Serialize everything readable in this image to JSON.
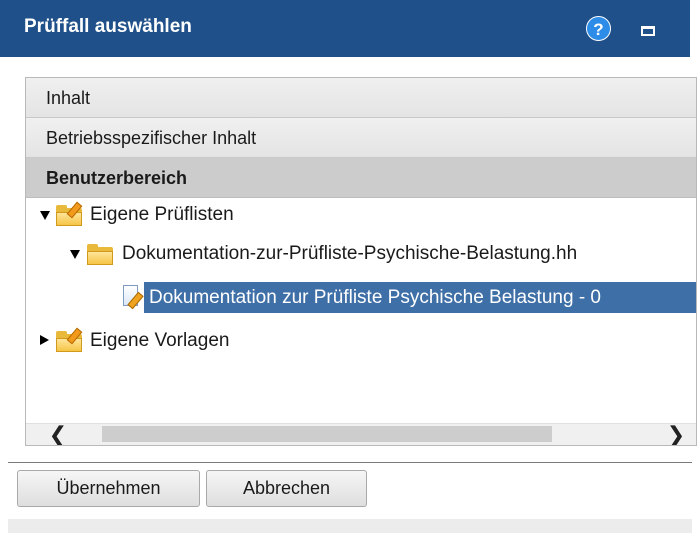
{
  "dialog": {
    "title": "Prüffall auswählen",
    "help_icon": "help-icon",
    "help_glyph": "?",
    "maximize_icon": "maximize-icon"
  },
  "accordion": {
    "sections": [
      {
        "label": "Inhalt"
      },
      {
        "label": "Betriebsspezifischer Inhalt"
      },
      {
        "label": "Benutzerbereich",
        "active": true
      }
    ]
  },
  "tree": {
    "nodes": [
      {
        "label": "Eigene Prüflisten",
        "icon": "folder-edit-icon",
        "expanded": true
      },
      {
        "label": "Dokumentation-zur-Prüfliste-Psychische-Belastung.hh",
        "icon": "folder-icon",
        "expanded": true
      },
      {
        "label": "Dokumentation zur Prüfliste Psychische Belastung - 0",
        "icon": "document-edit-icon",
        "selected": true
      },
      {
        "label": "Eigene Vorlagen",
        "icon": "folder-edit-icon",
        "expanded": false
      }
    ]
  },
  "scrollbar": {
    "left_glyph": "❮",
    "right_glyph": "❯"
  },
  "buttons": {
    "ok_label": "Übernehmen",
    "cancel_label": "Abbrechen"
  },
  "colors": {
    "titlebar": "#1f5089",
    "selection": "#3f6fa7",
    "active_section": "#cccccc"
  }
}
